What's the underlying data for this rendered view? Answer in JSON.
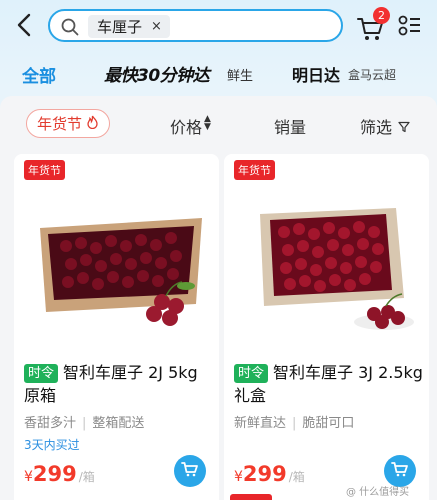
{
  "search": {
    "query_chip": "车厘子",
    "chip_close": "×"
  },
  "cart": {
    "badge_count": "2"
  },
  "tabs": {
    "all": "全部",
    "fast_brand": "最快30分钟达",
    "fast_sub": "鲜生",
    "next_brand": "明日达",
    "next_sub": "盒马云超"
  },
  "sort": {
    "festival": "年货节",
    "price": "价格",
    "sales": "销量",
    "filter": "筛选"
  },
  "products": [
    {
      "badge": "年货节",
      "tag": "时令",
      "title": "智利车厘子 2J 5kg 原箱",
      "feature1": "香甜多汁",
      "feature2": "整箱配送",
      "delivery": "3天内买过",
      "currency": "¥",
      "price": "299",
      "unit": "/箱"
    },
    {
      "badge": "年货节",
      "tag": "时令",
      "title": "智利车厘子 3J 2.5kg 礼盒",
      "feature1": "新鲜直达",
      "feature2": "脆甜可口",
      "delivery": "",
      "currency": "¥",
      "price": "299",
      "unit": "/箱"
    }
  ],
  "watermark": "@ 什么值得买",
  "colors": {
    "accent": "#2aa6e8",
    "price": "#f23a2a",
    "badge": "#e8262a",
    "seasonal": "#1fb15a"
  },
  "icons": [
    "back-arrow-icon",
    "search-icon",
    "cart-icon",
    "menu-icon",
    "flame-icon",
    "sort-arrows-icon",
    "funnel-icon",
    "add-cart-icon"
  ]
}
